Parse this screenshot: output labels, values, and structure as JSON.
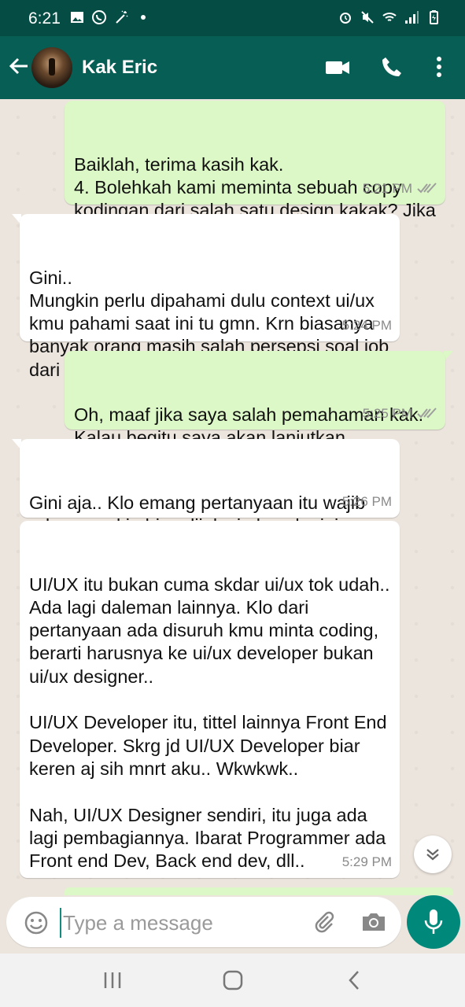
{
  "status_bar": {
    "time": "6:21",
    "left_icons": [
      "image-icon",
      "whatsapp-icon",
      "magic-wand-icon",
      "dot-icon"
    ],
    "right_icons": [
      "alarm-icon",
      "mute-icon",
      "wifi-icon",
      "signal-icon",
      "battery-icon"
    ]
  },
  "header": {
    "contact_name": "Kak Eric",
    "actions": [
      "video-call-icon",
      "voice-call-icon",
      "more-options-icon"
    ]
  },
  "messages": [
    {
      "direction": "out",
      "text": "Baiklah, terima kasih kak.\n4. Bolehkah kami meminta sebuah copy kodingan dari salah satu design kakak? Jika diperbolehkan",
      "time": "5:21 PM",
      "read": true
    },
    {
      "direction": "in",
      "text": "Gini..\nMungkin perlu dipahami dulu context ui/ux kmu pahami saat ini tu gmn. Krn biasanya banyak orang masih salah persepsi soal job dari ui/ux..",
      "time": "5:24 PM"
    },
    {
      "direction": "out",
      "text": "Oh, maaf jika saya salah pemahaman kak. Kalau begitu saya akan lanjutkan",
      "time": "5:25 PM",
      "read": true
    },
    {
      "direction": "in",
      "text": "Gini aja.. Klo emang pertanyaan itu wajib ada, mungkin bisa dijelasin kayak gini..",
      "time": "5:26 PM"
    },
    {
      "direction": "in",
      "text": "UI/UX itu bukan cuma skdar ui/ux tok udah..\nAda lagi daleman lainnya. Klo dari pertanyaan ada disuruh kmu minta coding, berarti harusnya ke ui/ux developer bukan ui/ux designer..\n\nUI/UX Developer itu, tittel lainnya Front End Developer. Skrg jd UI/UX Developer biar keren aj sih mnrt aku.. Wkwkwk..\n\nNah, UI/UX Designer sendiri, itu juga ada lagi pembagiannya. Ibarat Programmer ada Front end Dev, Back end dev, dll..",
      "time": "5:29 PM"
    }
  ],
  "composer": {
    "placeholder": "Type a message",
    "value": ""
  },
  "colors": {
    "app_bar": "#075e54",
    "status_bar": "#054d44",
    "outgoing_bubble": "#dcf8c6",
    "incoming_bubble": "#ffffff",
    "chat_background": "#ece5dd",
    "accent": "#00897b",
    "read_ticks": "#9e9e9e"
  }
}
